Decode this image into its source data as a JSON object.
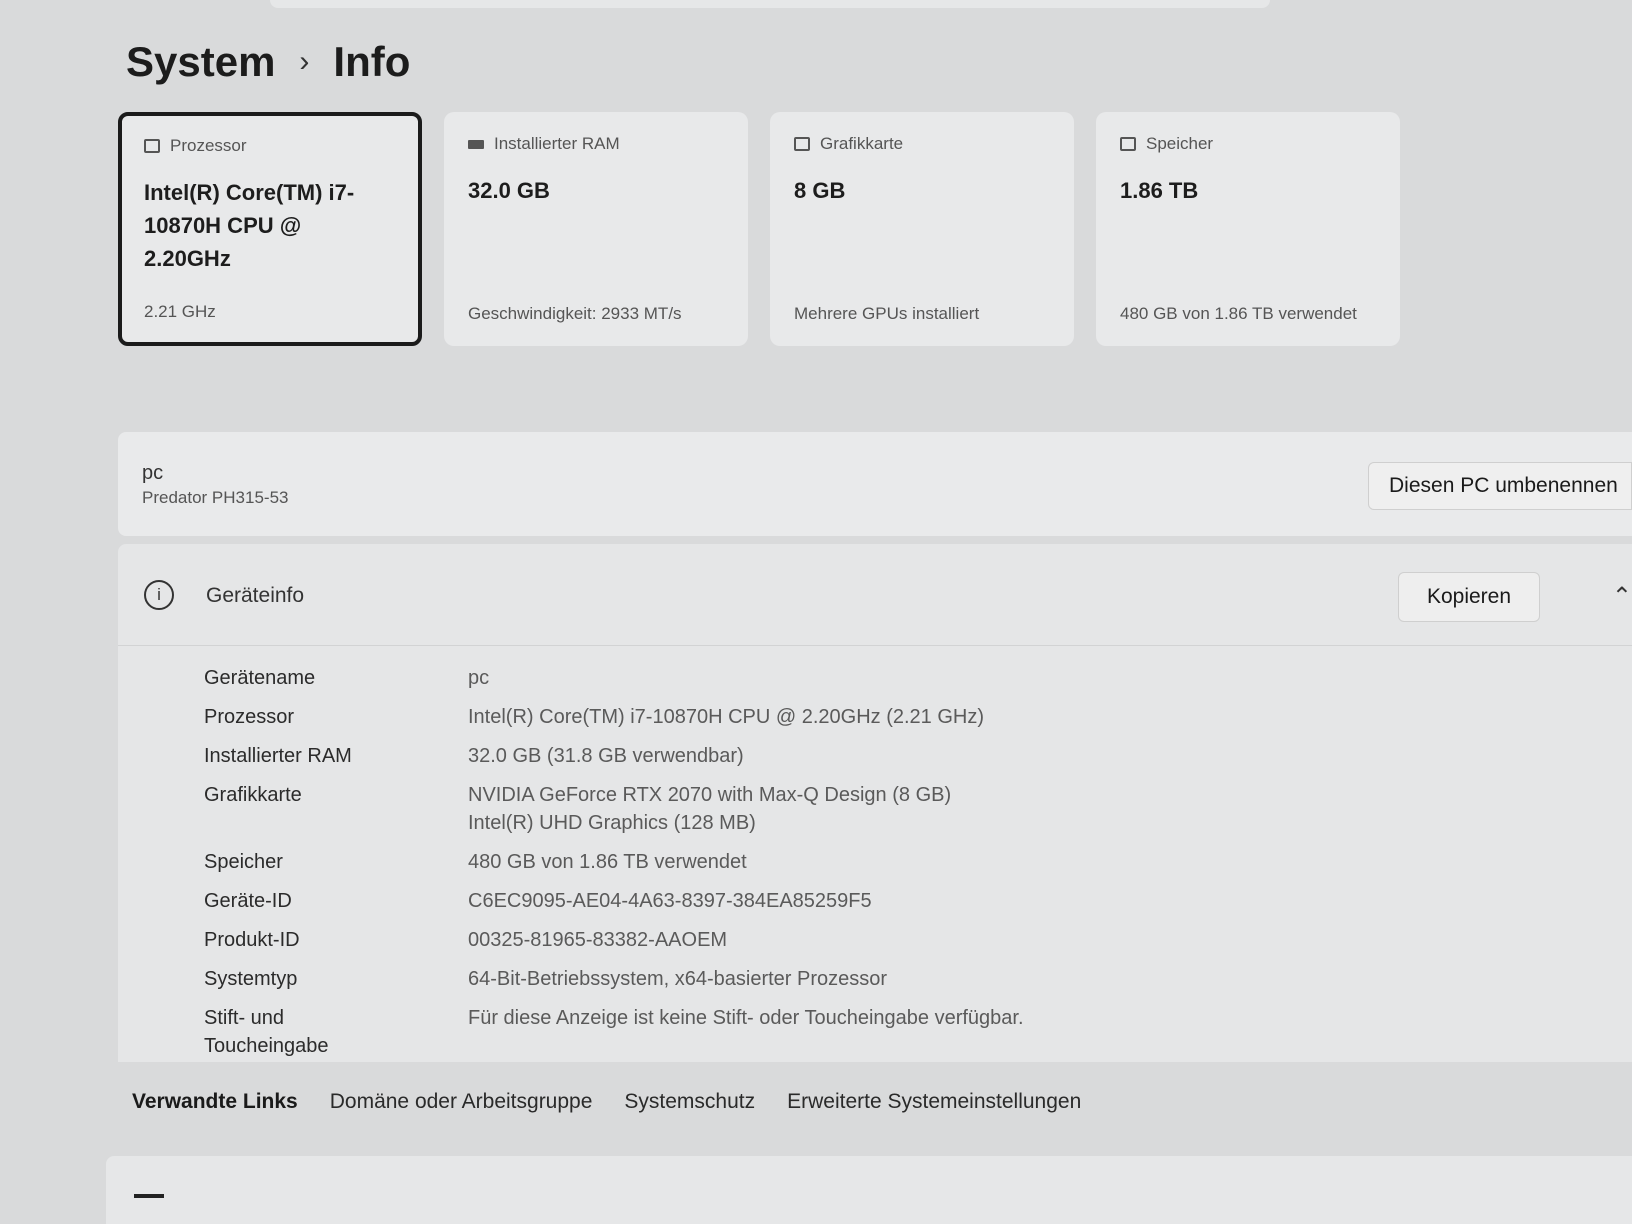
{
  "breadcrumb": {
    "parent": "System",
    "separator": "›",
    "current": "Info"
  },
  "cards": [
    {
      "icon": "processor-icon",
      "title": "Prozessor",
      "value": "Intel(R) Core(TM) i7-10870H CPU @ 2.20GHz",
      "sub": "2.21 GHz",
      "selected": true
    },
    {
      "icon": "ram-icon",
      "title": "Installierter RAM",
      "value": "32.0 GB",
      "sub": "Geschwindigkeit: 2933 MT/s"
    },
    {
      "icon": "graphics-card-icon",
      "title": "Grafikkarte",
      "value": "8 GB",
      "sub": "Mehrere GPUs installiert"
    },
    {
      "icon": "storage-icon",
      "title": "Speicher",
      "value": "1.86 TB",
      "sub": "480 GB von 1.86 TB verwendet"
    }
  ],
  "pc": {
    "name": "pc",
    "model": "Predator PH315-53",
    "rename_label": "Diesen PC umbenennen"
  },
  "device_info": {
    "title": "Geräteinfo",
    "copy_label": "Kopieren",
    "rows": [
      {
        "label": "Gerätename",
        "value": "pc"
      },
      {
        "label": "Prozessor",
        "value": "Intel(R) Core(TM) i7-10870H CPU @ 2.20GHz (2.21 GHz)"
      },
      {
        "label": "Installierter RAM",
        "value": "32.0 GB (31.8 GB verwendbar)"
      },
      {
        "label": "Grafikkarte",
        "value": "NVIDIA GeForce RTX 2070 with Max-Q Design (8 GB)",
        "value2": "Intel(R) UHD Graphics (128 MB)"
      },
      {
        "label": "Speicher",
        "value": "480 GB von 1.86 TB verwendet"
      },
      {
        "label": "Geräte-ID",
        "value": "C6EC9095-AE04-4A63-8397-384EA85259F5"
      },
      {
        "label": "Produkt-ID",
        "value": "00325-81965-83382-AAOEM"
      },
      {
        "label": "Systemtyp",
        "value": "64-Bit-Betriebssystem, x64-basierter Prozessor"
      },
      {
        "label": "Stift- und Toucheingabe",
        "value": "Für diese Anzeige ist keine Stift- oder Toucheingabe verfügbar."
      }
    ]
  },
  "related_links": {
    "title": "Verwandte Links",
    "links": [
      "Domäne oder Arbeitsgruppe",
      "Systemschutz",
      "Erweiterte Systemeinstellungen"
    ]
  }
}
